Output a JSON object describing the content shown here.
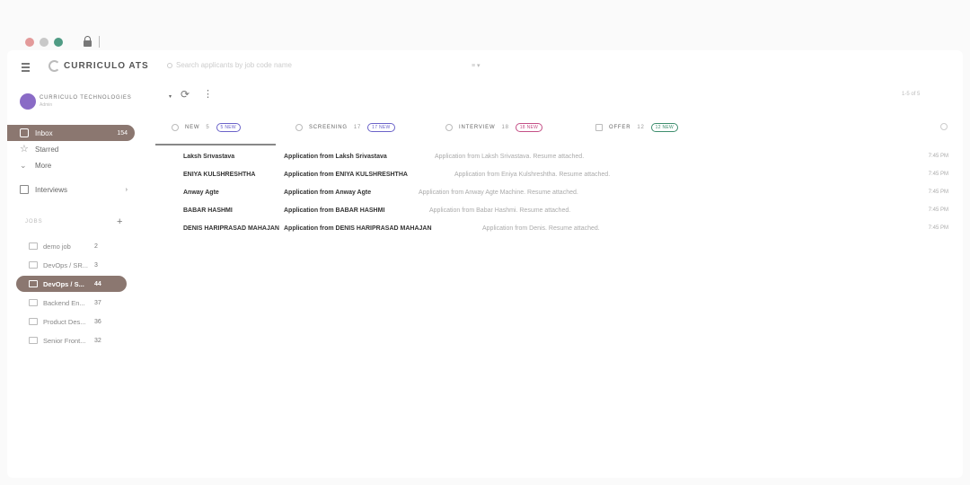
{
  "browser": {
    "traffic_colors": [
      "#e39a9a",
      "#c8c8c8",
      "#4f9b84"
    ]
  },
  "header": {
    "brand": "CURRICULO ATS",
    "search_placeholder": "Search applicants by job code name",
    "filter_icon": "sliders-icon"
  },
  "org": {
    "name": "CURRICULO TECHNOLOGIES",
    "sub": "Admin",
    "avatar_color": "#8a6bc6"
  },
  "nav": {
    "inbox": {
      "label": "Inbox",
      "count": "154"
    },
    "starred": {
      "label": "Starred"
    },
    "more": {
      "label": "More"
    },
    "interviews": {
      "label": "Interviews",
      "chevron": "›"
    }
  },
  "jobs": {
    "heading": "JOBS",
    "add": "+",
    "items": [
      {
        "label": "demo job",
        "count": "2"
      },
      {
        "label": "DevOps / SR...",
        "count": "3"
      },
      {
        "label": "DevOps / S...",
        "count": "44"
      },
      {
        "label": "Backend En...",
        "count": "37"
      },
      {
        "label": "Product Des...",
        "count": "36"
      },
      {
        "label": "Senior Front...",
        "count": "32"
      }
    ]
  },
  "toolbar": {
    "pager": "1-5 of 5"
  },
  "tabs": [
    {
      "label": "NEW",
      "count": "5",
      "badge": "5 NEW",
      "badge_color": "#6b63c9"
    },
    {
      "label": "SCREENING",
      "count": "17",
      "badge": "17 NEW",
      "badge_color": "#6b63c9"
    },
    {
      "label": "INTERVIEW",
      "count": "18",
      "badge": "18 NEW",
      "badge_color": "#c44f86"
    },
    {
      "label": "OFFER",
      "count": "12",
      "badge": "12 NEW",
      "badge_color": "#3e8e6e"
    }
  ],
  "accent": "#8b7770",
  "rows": [
    {
      "sender": "Laksh Srivastava",
      "subject": "Application from Laksh Srivastava",
      "snippet": "Application from Laksh Srivastava. Resume attached.",
      "time": "7:45 PM"
    },
    {
      "sender": "ENIYA KULSHRESHTHA",
      "subject": "Application from ENIYA KULSHRESHTHA",
      "snippet": "Application from Eniya Kulshreshtha. Resume attached.",
      "time": "7:45 PM"
    },
    {
      "sender": "Anway Agte",
      "subject": "Application from Anway Agte",
      "snippet": "Application from Anway Agte Machine. Resume attached.",
      "time": "7:45 PM"
    },
    {
      "sender": "BABAR HASHMI",
      "subject": "Application from BABAR HASHMI",
      "snippet": "Application from Babar Hashmi. Resume attached.",
      "time": "7:45 PM"
    },
    {
      "sender": "DENIS HARIPRASAD MAHAJAN",
      "subject": "Application from DENIS HARIPRASAD MAHAJAN",
      "snippet": "Application from Denis. Resume attached.",
      "time": "7:45 PM"
    }
  ]
}
